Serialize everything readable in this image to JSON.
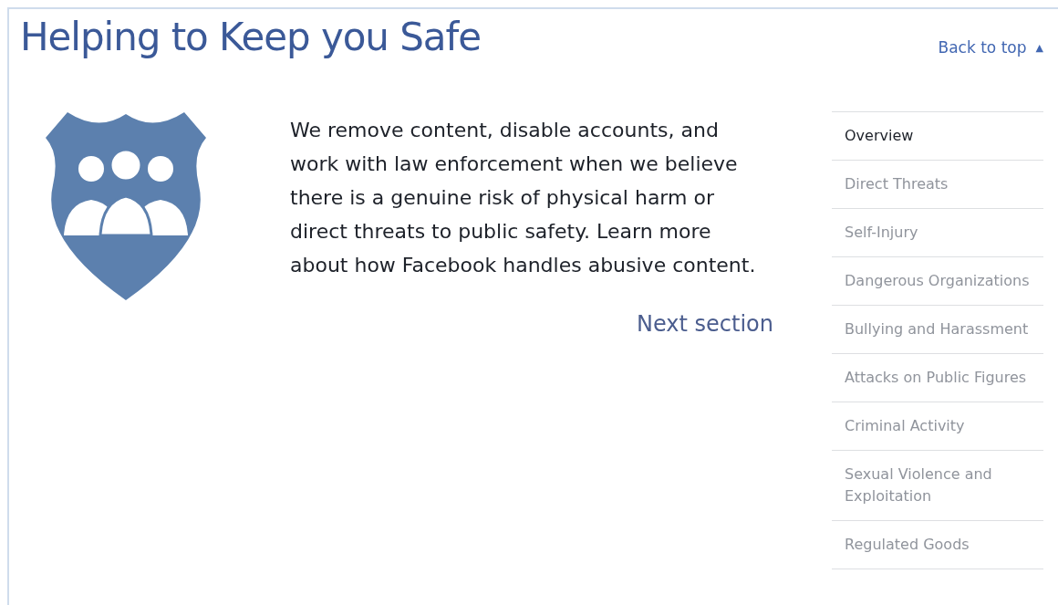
{
  "title": "Helping to Keep you Safe",
  "back_to_top": "Back to top",
  "back_to_top_icon": "▲",
  "body": "We remove content, disable accounts, and work with law enforcement when we believe there is a genuine risk of physical harm or direct threats to public safety. Learn more about how Facebook handles abusive content.",
  "next_section": "Next section",
  "nav": [
    {
      "label": "Overview",
      "selected": true
    },
    {
      "label": "Direct Threats",
      "selected": false
    },
    {
      "label": "Self-Injury",
      "selected": false
    },
    {
      "label": "Dangerous Organizations",
      "selected": false
    },
    {
      "label": "Bullying and Harassment",
      "selected": false
    },
    {
      "label": "Attacks on Public Figures",
      "selected": false
    },
    {
      "label": "Criminal Activity",
      "selected": false
    },
    {
      "label": "Sexual Violence and Exploitation",
      "selected": false
    },
    {
      "label": "Regulated Goods",
      "selected": false
    }
  ]
}
